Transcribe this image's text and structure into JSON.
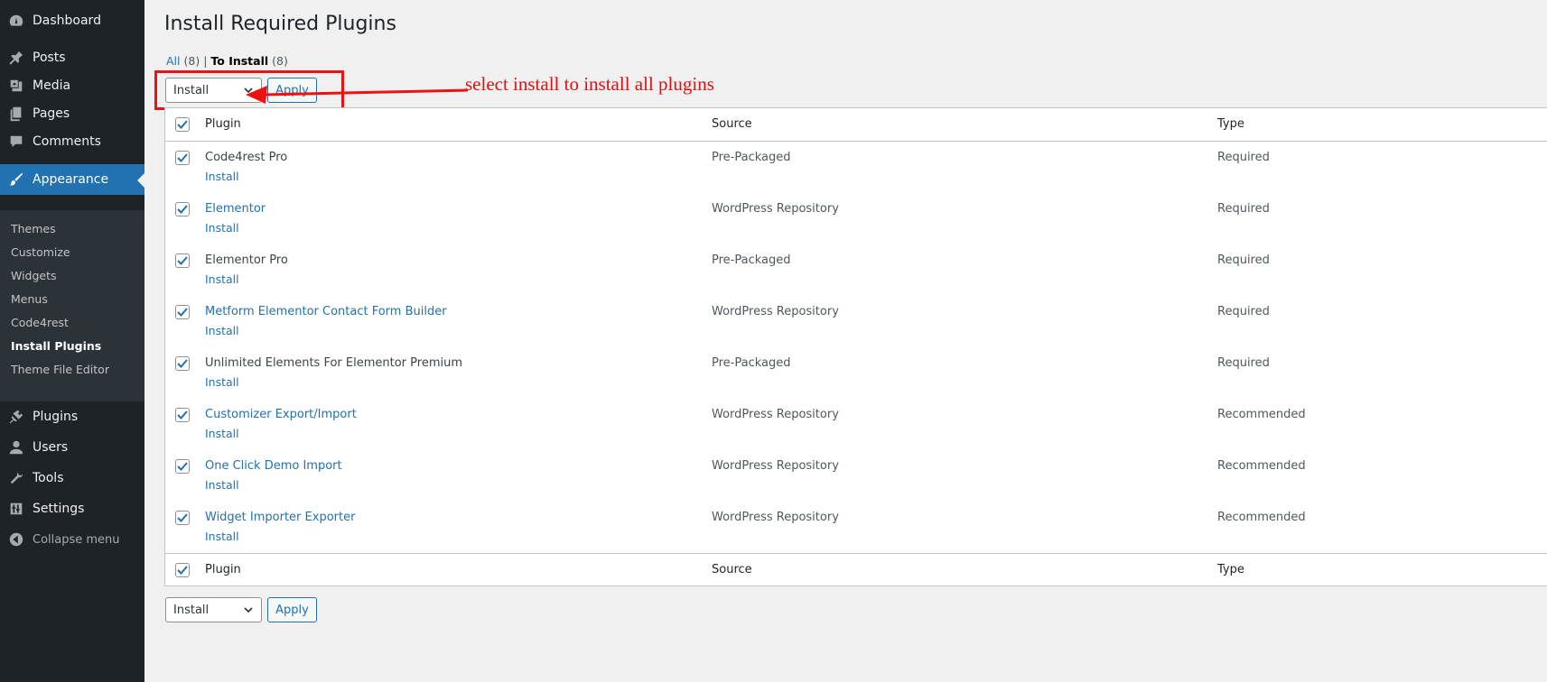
{
  "sidebar": {
    "dashboard": "Dashboard",
    "posts": "Posts",
    "media": "Media",
    "pages": "Pages",
    "comments": "Comments",
    "appearance": "Appearance",
    "submenu": [
      "Themes",
      "Customize",
      "Widgets",
      "Menus",
      "Code4rest",
      "Install Plugins",
      "Theme File Editor"
    ],
    "plugins": "Plugins",
    "users": "Users",
    "tools": "Tools",
    "settings": "Settings",
    "collapse": "Collapse menu"
  },
  "page": {
    "title": "Install Required Plugins",
    "filters": {
      "all_label": "All",
      "all_count": "(8)",
      "separator": "|",
      "to_install_label": "To Install",
      "to_install_count": "(8)"
    }
  },
  "bulk_actions": {
    "selected": "Install",
    "apply_label": "Apply"
  },
  "annotation": {
    "text": "select install to install all plugins",
    "color": "#e01010"
  },
  "table": {
    "columns": [
      "Plugin",
      "Source",
      "Type"
    ],
    "row_action": "Install",
    "rows": [
      {
        "name": "Code4rest Pro",
        "source": "Pre-Packaged",
        "type": "Required"
      },
      {
        "name": "Elementor",
        "source": "WordPress Repository",
        "type": "Required"
      },
      {
        "name": "Elementor Pro",
        "source": "Pre-Packaged",
        "type": "Required"
      },
      {
        "name": "Metform Elementor Contact Form Builder",
        "source": "WordPress Repository",
        "type": "Required"
      },
      {
        "name": "Unlimited Elements For Elementor Premium",
        "source": "Pre-Packaged",
        "type": "Required"
      },
      {
        "name": "Customizer Export/Import",
        "source": "WordPress Repository",
        "type": "Recommended"
      },
      {
        "name": "One Click Demo Import",
        "source": "WordPress Repository",
        "type": "Recommended"
      },
      {
        "name": "Widget Importer Exporter",
        "source": "WordPress Repository",
        "type": "Recommended"
      }
    ]
  },
  "colors": {
    "sidebar_bg": "#1d2327",
    "accent": "#2271b1",
    "annotation_red": "#ee1111"
  }
}
